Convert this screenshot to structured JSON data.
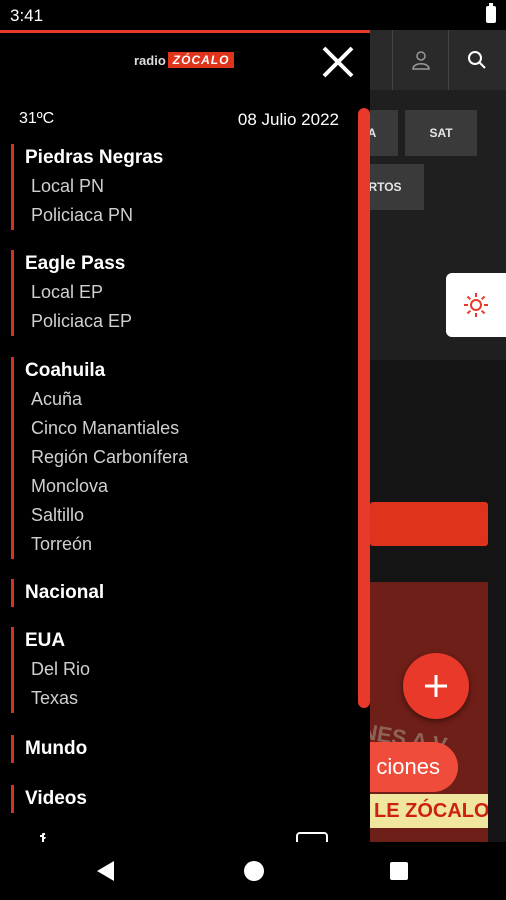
{
  "status_bar": {
    "time": "3:41"
  },
  "background": {
    "chips": [
      "A",
      "SAT",
      "RTOS"
    ],
    "pill_text": "ciones",
    "banner_text": "LE ZÓCALO",
    "banner_stripe": "NES A V"
  },
  "drawer": {
    "logo": {
      "radio": "radio",
      "zocalo": "ZÓCALO"
    },
    "temperature": "31ºC",
    "date": "08 Julio 2022",
    "sections": [
      {
        "title": "Piedras Negras",
        "items": [
          "Local PN",
          "Policiaca PN"
        ]
      },
      {
        "title": "Eagle Pass",
        "items": [
          "Local EP",
          "Policiaca EP"
        ]
      },
      {
        "title": "Coahuila",
        "items": [
          "Acuña",
          "Cinco Manantiales",
          "Región Carbonífera",
          "Monclova",
          "Saltillo",
          "Torreón"
        ]
      },
      {
        "title": "Nacional",
        "items": []
      },
      {
        "title": "EUA",
        "items": [
          "Del Rio",
          "Texas"
        ]
      },
      {
        "title": "Mundo",
        "items": []
      },
      {
        "title": "Videos",
        "items": []
      }
    ]
  },
  "colors": {
    "accent": "#e8392a",
    "drawer_bg": "#000000",
    "app_bg": "#1f1f1f"
  }
}
